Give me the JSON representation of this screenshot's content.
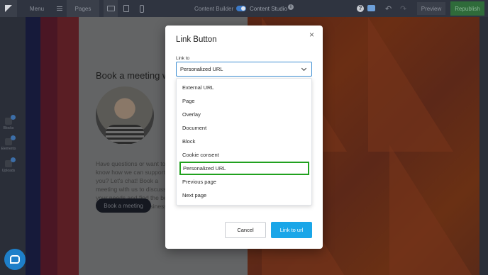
{
  "toolbar": {
    "menu_label": "Menu",
    "pages_label": "Pages",
    "content_builder_label": "Content Builder",
    "content_studio_label": "Content Studio",
    "preview_label": "Preview",
    "republish_label": "Republish"
  },
  "sidebar": {
    "items": [
      {
        "label": "Blocks",
        "icon": "blocks-icon"
      },
      {
        "label": "Elements",
        "icon": "text-element-icon"
      },
      {
        "label": "Uploads",
        "icon": "uploads-icon"
      }
    ]
  },
  "canvas": {
    "heading": "Book a meeting wi",
    "paragraph": "Have questions or want to know how we can support you? Let's chat! Book a meeting with us to discuss your needs and find the best solutions for your business.",
    "cta_label": "Book a meeting"
  },
  "modal": {
    "title": "Link Button",
    "close_label": "×",
    "field_label": "Link to",
    "selected_value": "Personalized URL",
    "options": [
      "External URL",
      "Page",
      "Overlay",
      "Document",
      "Block",
      "Cookie consent",
      "Personalized URL",
      "Previous page",
      "Next page"
    ],
    "highlighted_option": "Personalized URL",
    "cancel_label": "Cancel",
    "confirm_label": "Link to url"
  },
  "colors": {
    "primary_button": "#1aa6e8",
    "highlight_outline": "#21a11f",
    "select_border": "#3f8fd3",
    "republish": "#2f6b3a"
  }
}
